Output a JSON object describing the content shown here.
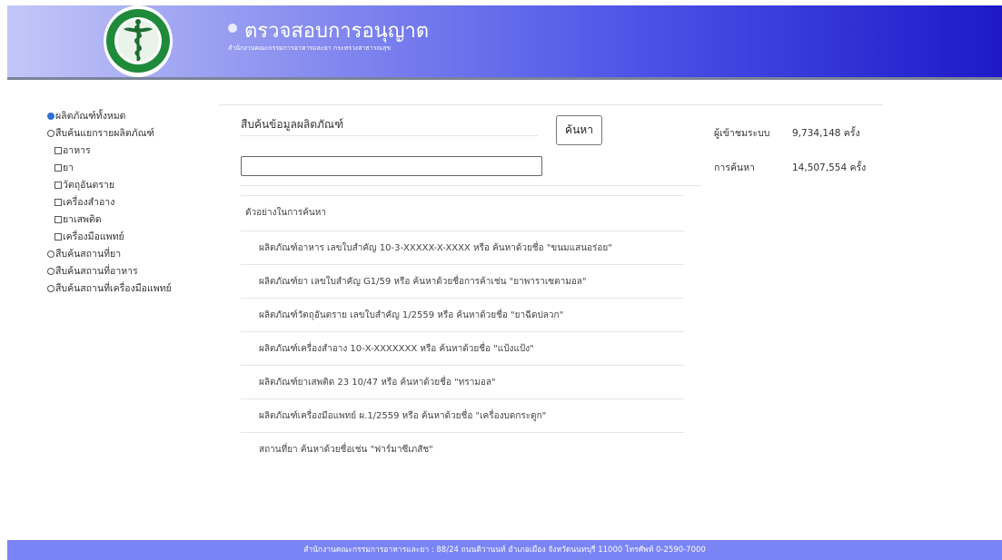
{
  "header": {
    "title": "ตรวจสอบการอนุญาต",
    "subtitle": "สำนักงานคณะกรรมการอาหารและยา กระทรวงสาธารณสุข",
    "logo_icon": "caduceus-emblem-icon",
    "logo_text": "MINISTRY OF PUBLIC HEALTH",
    "gradient_start": "#c3c7f7",
    "gradient_end": "#1d19c8"
  },
  "sidebar": {
    "options": [
      {
        "label": "ผลิตภัณฑ์ทั้งหมด",
        "type": "radio",
        "checked": true
      },
      {
        "label": "สืบค้นแยกรายผลิตภัณฑ์",
        "type": "radio",
        "checked": false
      },
      {
        "label": "อาหาร",
        "type": "checkbox",
        "checked": false
      },
      {
        "label": "ยา",
        "type": "checkbox",
        "checked": false
      },
      {
        "label": "วัตถุอันตราย",
        "type": "checkbox",
        "checked": false
      },
      {
        "label": "เครื่องสำอาง",
        "type": "checkbox",
        "checked": false
      },
      {
        "label": "ยาเสพติด",
        "type": "checkbox",
        "checked": false
      },
      {
        "label": "เครื่องมือแพทย์",
        "type": "checkbox",
        "checked": false
      },
      {
        "label": "สืบค้นสถานที่ยา",
        "type": "radio",
        "checked": false
      },
      {
        "label": "สืบค้นสถานที่อาหาร",
        "type": "radio",
        "checked": false
      },
      {
        "label": "สืบค้นสถานที่เครื่องมือแพทย์",
        "type": "radio",
        "checked": false
      }
    ]
  },
  "search": {
    "title": "สืบค้นข้อมูลผลิตภัณฑ์",
    "button_label": "ค้นหา",
    "input_value": "",
    "input_placeholder": ""
  },
  "examples": {
    "heading": "ตัวอย่างในการค้นหา",
    "items": [
      "ผลิตภัณฑ์อาหาร เลขใบสำคัญ 10-3-XXXXX-X-XXXX หรือ ค้นหาด้วยชื่อ  \"ขนมแสนอร่อย\"",
      "ผลิตภัณฑ์ยา เลขใบสำคัญ G1/59 หรือ ค้นหาด้วยชื่อการค้าเช่น \"ยาพาราเซตามอล\"",
      "ผลิตภัณฑ์วัตถุอันตราย เลขใบสำคัญ 1/2559 หรือ ค้นหาด้วยชื่อ \"ยาฉีดปลวก\"",
      "ผลิตภัณฑ์เครื่องสำอาง 10-X-XXXXXXX หรือ ค้นหาด้วยชื่อ \"แป้งแป้ง\"",
      "ผลิตภัณฑ์ยาเสพติด 23 10/47 หรือ ค้นหาด้วยชื่อ \"ทรามอล\"",
      "ผลิตภัณฑ์เครื่องมือแพทย์ ผ.1/2559 หรือ ค้นหาด้วยชื่อ \"เครื่องบดกระดูก\"",
      "สถานที่ยา ค้นหาด้วยชื่อเช่น \"ฟาร์มาซีเภสัช\""
    ]
  },
  "stats": {
    "visitors_label": "ผู้เข้าชมระบบ",
    "visitors_value": "9,734,148 ครั้ง",
    "searches_label": "การค้นหา",
    "searches_value": "14,507,554 ครั้ง"
  },
  "footer": {
    "text": "สำนักงานคณะกรรมการอาหารและยา : 88/24 ถนนติวานนท์ อำเภอเมือง จังหวัดนนทบุรี 11000 โทรศัพท์ 0-2590-7000"
  }
}
